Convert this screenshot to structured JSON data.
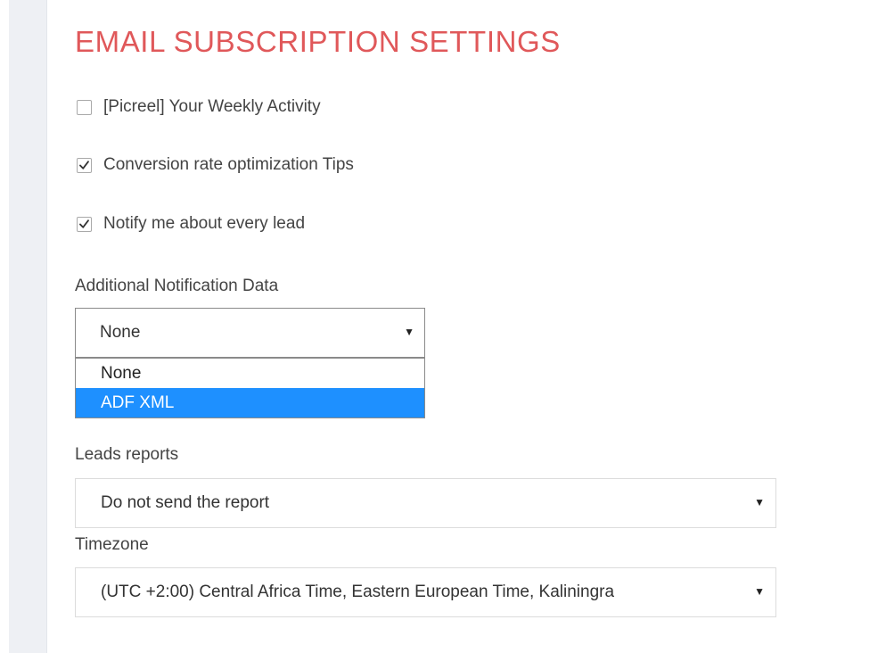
{
  "title": "EMAIL SUBSCRIPTION SETTINGS",
  "checkboxes": [
    {
      "label": "[Picreel] Your Weekly Activity",
      "checked": false
    },
    {
      "label": "Conversion rate optimization Tips",
      "checked": true
    },
    {
      "label": "Notify me about every lead",
      "checked": true
    }
  ],
  "notification": {
    "label": "Additional Notification Data",
    "selected": "None",
    "options": [
      "None",
      "ADF XML"
    ],
    "highlighted_option": "ADF XML"
  },
  "leads_reports": {
    "label": "Leads reports",
    "selected": "Do not send the report"
  },
  "timezone": {
    "label": "Timezone",
    "selected": "(UTC +2:00) Central Africa Time, Eastern European Time, Kaliningra"
  },
  "icons": {
    "dropdown_arrow": "▼",
    "check": "check-icon"
  },
  "colors": {
    "title": "#e0585a",
    "highlight": "#1e90ff",
    "side_strip": "#eef0f4"
  }
}
